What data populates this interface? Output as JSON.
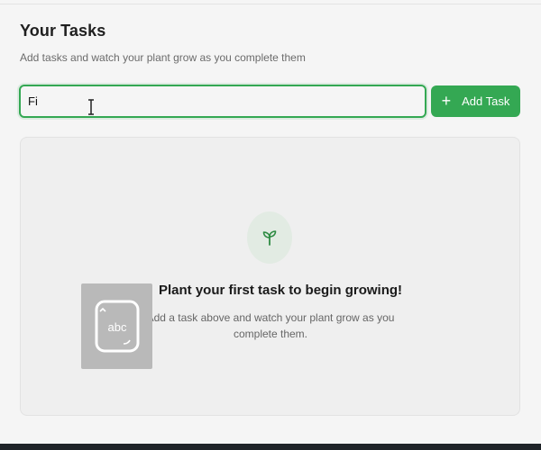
{
  "header": {
    "title": "Your Tasks",
    "subtitle": "Add tasks and watch your plant grow as you complete them"
  },
  "task_input": {
    "value": "Fi",
    "placeholder": ""
  },
  "add_button": {
    "icon": "plus-icon",
    "label": "Add Task"
  },
  "empty_state": {
    "icon": "sprout-icon",
    "heading": "Plant your first task to begin growing!",
    "text": "Add a task above and watch your plant grow as you complete them."
  },
  "ime_overlay": {
    "icon": "keyboard-abc-icon",
    "label": "abc"
  },
  "colors": {
    "accent": "#34a853",
    "background": "#f5f5f5",
    "card": "#efefef",
    "bottom_bar": "#1f2328"
  }
}
